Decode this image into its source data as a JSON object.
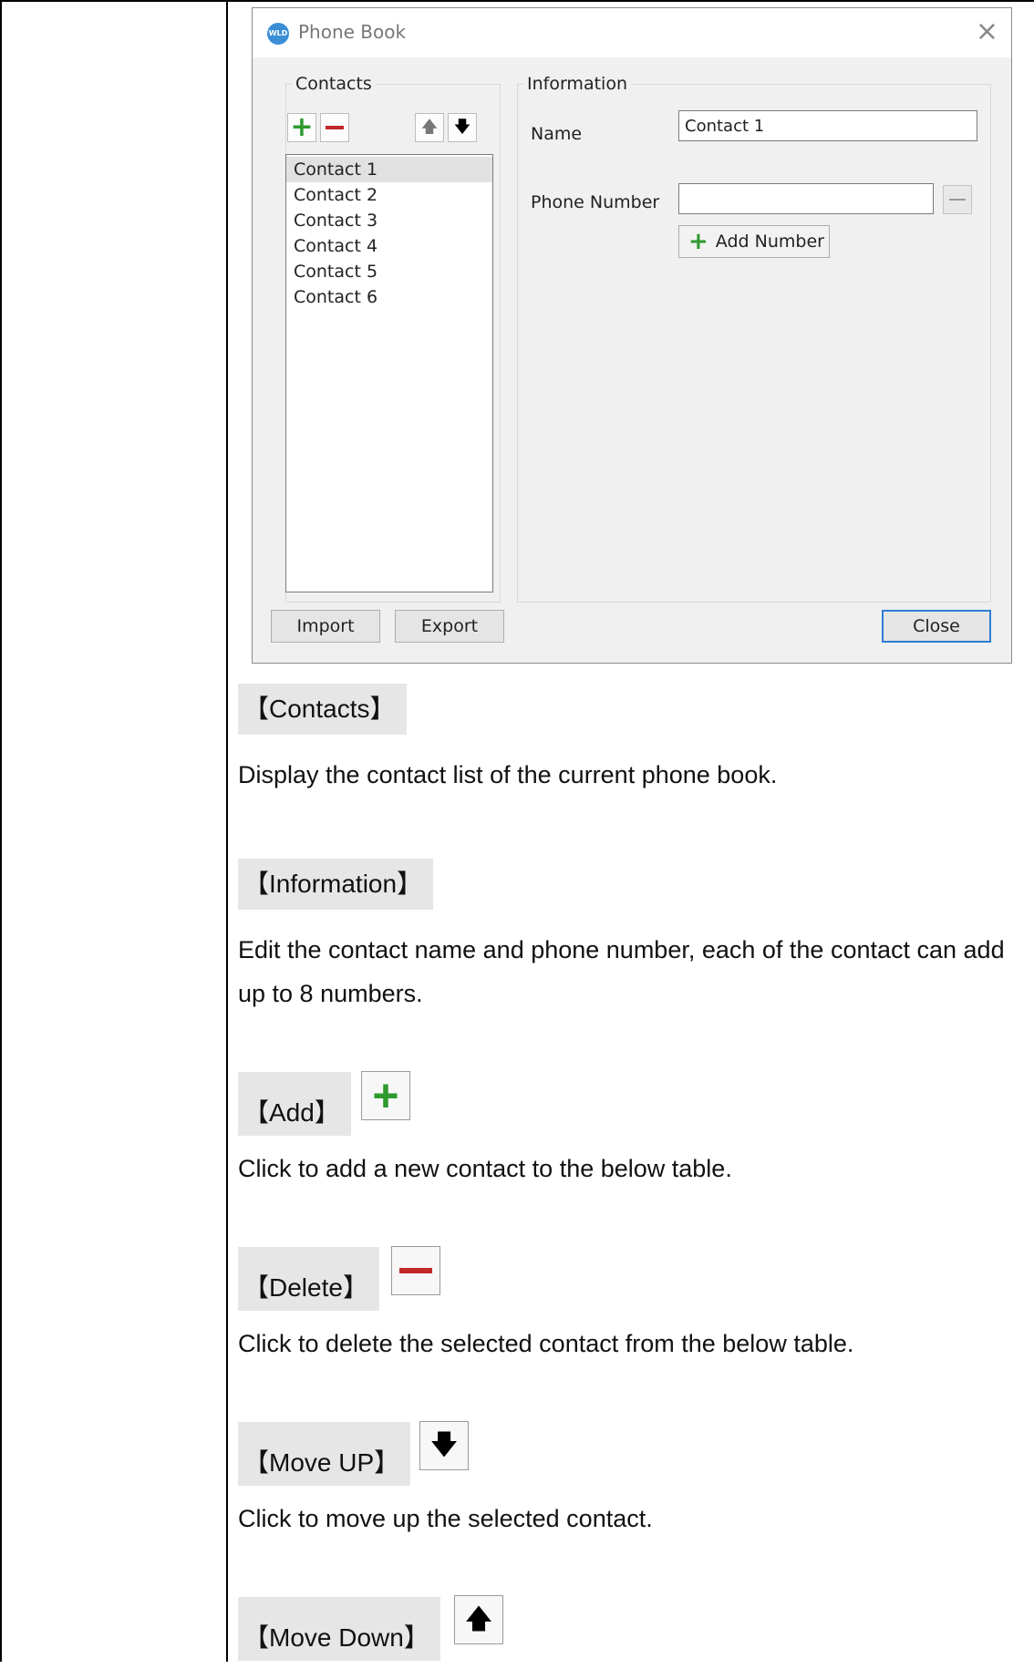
{
  "dialog": {
    "title": "Phone Book",
    "logo_text": "WLD",
    "close_glyph": "×",
    "contacts_group": {
      "legend": "Contacts",
      "items": [
        "Contact 1",
        "Contact 2",
        "Contact 3",
        "Contact 4",
        "Contact 5",
        "Contact 6"
      ],
      "selected_index": 0
    },
    "info_group": {
      "legend": "Information",
      "name_label": "Name",
      "name_value": "Contact 1",
      "phone_label": "Phone Number",
      "phone_value": "",
      "add_number_label": "Add Number"
    },
    "buttons": {
      "import": "Import",
      "export": "Export",
      "close": "Close"
    },
    "icons": {
      "add": "plus-icon",
      "delete": "minus-icon",
      "move_up": "arrow-up-icon",
      "move_down": "arrow-down-icon"
    },
    "colors": {
      "plus": "#2e9a2e",
      "minus": "#c0282a",
      "primary_border": "#2f7bd6"
    }
  },
  "doc": {
    "contacts_heading": "【Contacts】",
    "contacts_desc": "Display the contact list of the current phone book.",
    "information_heading": "【Information】",
    "information_desc": "Edit the contact name and phone number, each of the contact can add up to 8 numbers.",
    "add_heading": "【Add】",
    "add_desc": "Click to add a new contact to the below table.",
    "delete_heading": "【Delete】",
    "delete_desc": "Click to delete the selected contact from the below table.",
    "move_up_heading": "【Move UP】",
    "move_up_desc": "Click to move up the selected contact.",
    "move_down_heading": "【Move Down】"
  }
}
